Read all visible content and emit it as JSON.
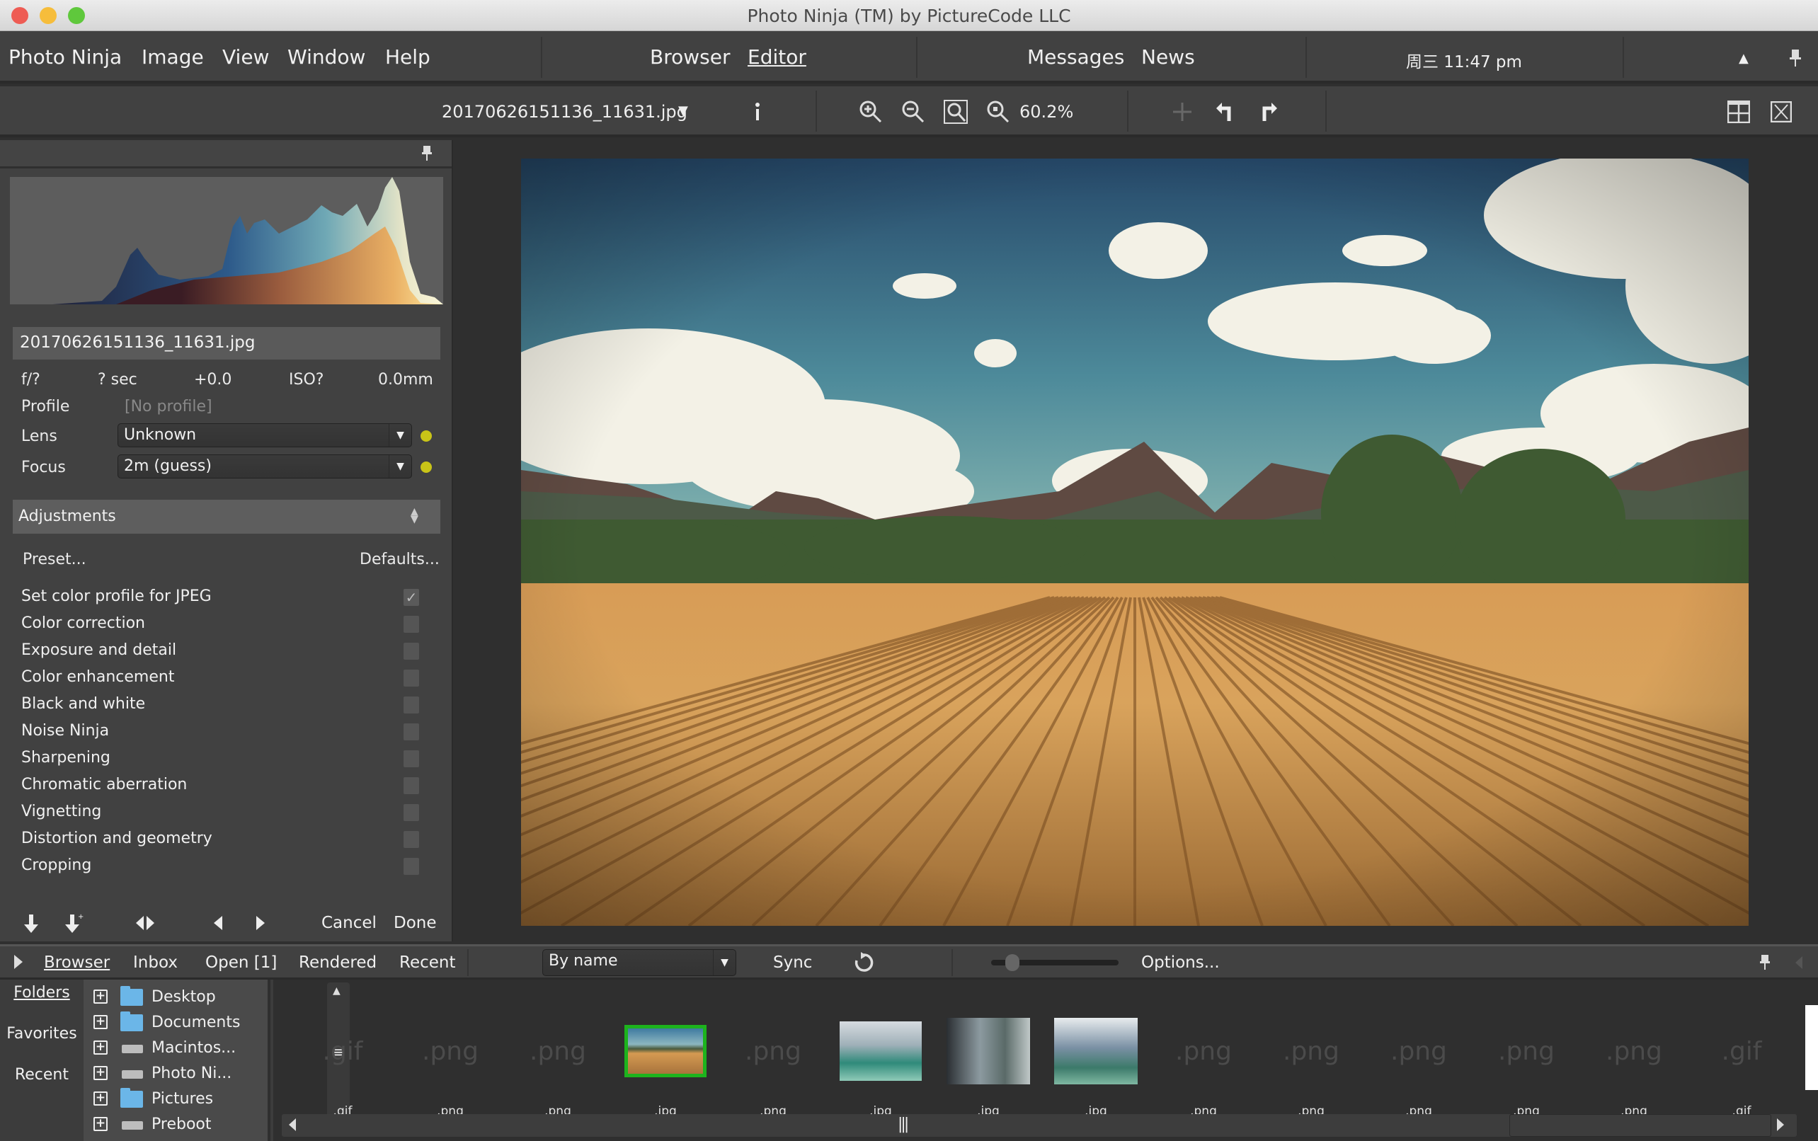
{
  "window": {
    "title": "Photo Ninja (TM) by PictureCode LLC",
    "traffic_lights": [
      "#ee5c54",
      "#f6bd3b",
      "#5fc83c"
    ]
  },
  "menubar": {
    "menus": [
      "Photo Ninja",
      "Image",
      "View",
      "Window",
      "Help"
    ],
    "modes": [
      "Browser",
      "Editor"
    ],
    "active_mode": "Editor",
    "extras": [
      "Messages",
      "News"
    ],
    "clock": "周三 11:47 pm"
  },
  "toolbar": {
    "filename": "20170626151136_11631.jpg",
    "zoom_level": "60.2%",
    "icons": [
      "info-icon",
      "zoom-in-icon",
      "zoom-out-icon",
      "fit-icon",
      "zoom-actual-icon",
      "pan-icon",
      "rotate-left-icon",
      "rotate-right-icon",
      "layout-icon",
      "close-view-icon"
    ]
  },
  "left_panel": {
    "filename": "20170626151136_11631.jpg",
    "exif": {
      "aperture": "f/?",
      "shutter": "? sec",
      "ev": "+0.0",
      "iso": "ISO?",
      "focal": "0.0mm"
    },
    "profile_label": "Profile",
    "profile_value": "[No profile]",
    "lens_label": "Lens",
    "lens_value": "Unknown",
    "focus_label": "Focus",
    "focus_value": "2m (guess)",
    "status_dot_color": "#c9c418",
    "adjustments_title": "Adjustments",
    "preset_label": "Preset...",
    "defaults_label": "Defaults...",
    "adjustments": [
      {
        "label": "Set color profile for JPEG",
        "checked": true
      },
      {
        "label": "Color correction",
        "checked": false
      },
      {
        "label": "Exposure and detail",
        "checked": false
      },
      {
        "label": "Color enhancement",
        "checked": false
      },
      {
        "label": "Black and white",
        "checked": false
      },
      {
        "label": "Noise Ninja",
        "checked": false
      },
      {
        "label": "Sharpening",
        "checked": false
      },
      {
        "label": "Chromatic aberration",
        "checked": false
      },
      {
        "label": "Vignetting",
        "checked": false
      },
      {
        "label": "Distortion and geometry",
        "checked": false
      },
      {
        "label": "Cropping",
        "checked": false
      }
    ],
    "cancel_label": "Cancel",
    "done_label": "Done"
  },
  "browser_bar": {
    "tabs": [
      "Browser",
      "Inbox",
      "Open [1]",
      "Rendered",
      "Recent"
    ],
    "active_tab": "Browser",
    "sort_value": "By name",
    "sync_label": "Sync",
    "options_label": "Options..."
  },
  "bottom": {
    "nav_tabs": [
      "Folders",
      "Favorites",
      "Recent"
    ],
    "active_nav": "Folders",
    "folders": [
      {
        "name": "Desktop",
        "type": "folder"
      },
      {
        "name": "Documents",
        "type": "folder"
      },
      {
        "name": "Macintos...",
        "type": "drive"
      },
      {
        "name": "Photo Ni...",
        "type": "drive"
      },
      {
        "name": "Pictures",
        "type": "folder"
      },
      {
        "name": "Preboot",
        "type": "drive"
      }
    ],
    "thumbnails": [
      {
        "ext": ".gif",
        "kind": "placeholder"
      },
      {
        "ext": ".png",
        "kind": "placeholder"
      },
      {
        "ext": ".png",
        "kind": "placeholder"
      },
      {
        "ext": ".jpg",
        "kind": "field",
        "selected": true
      },
      {
        "ext": ".png",
        "kind": "placeholder"
      },
      {
        "ext": ".jpg",
        "kind": "factory1"
      },
      {
        "ext": ".jpg",
        "kind": "factory2"
      },
      {
        "ext": ".jpg",
        "kind": "factory3"
      },
      {
        "ext": ".png",
        "kind": "placeholder"
      },
      {
        "ext": ".png",
        "kind": "placeholder"
      },
      {
        "ext": ".png",
        "kind": "placeholder"
      },
      {
        "ext": ".png",
        "kind": "placeholder"
      },
      {
        "ext": ".png",
        "kind": "placeholder"
      },
      {
        "ext": ".gif",
        "kind": "placeholder"
      }
    ],
    "selection_color": "#1db31d"
  }
}
